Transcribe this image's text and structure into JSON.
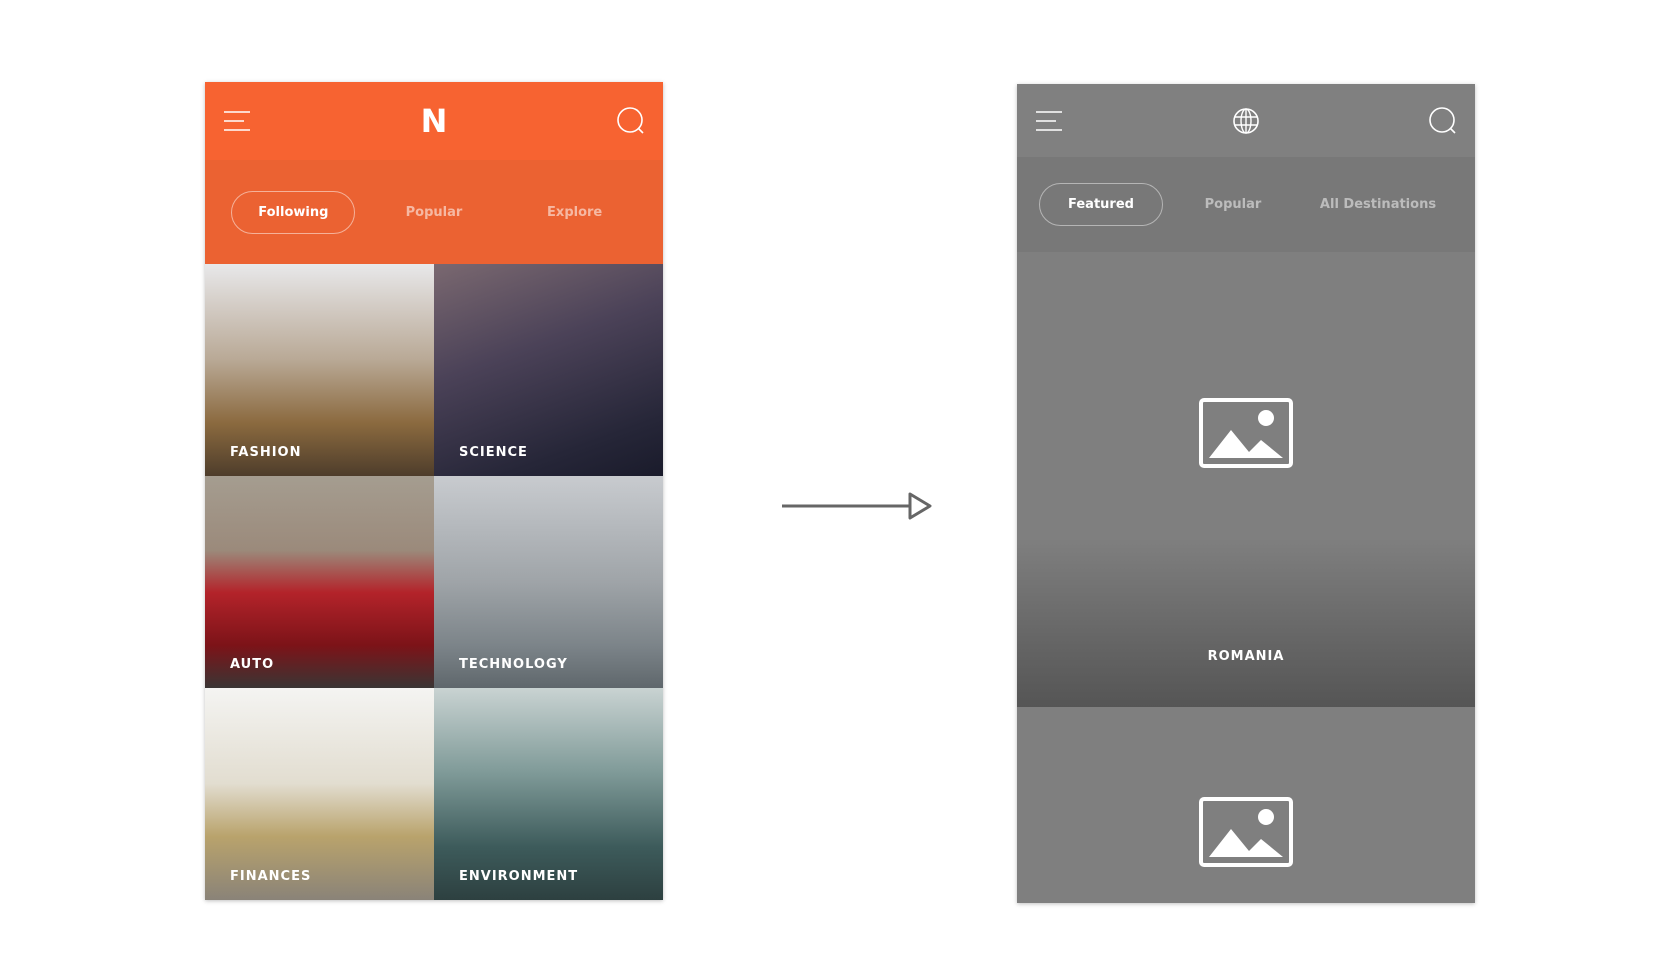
{
  "left_app": {
    "accent": "#f76331",
    "tabs": [
      "Following",
      "Popular",
      "Explore"
    ],
    "active_tab": "Following",
    "logo": "N",
    "categories": [
      "FASHION",
      "SCIENCE",
      "AUTO",
      "TECHNOLOGY",
      "FINANCES",
      "ENVIRONMENT"
    ]
  },
  "right_app": {
    "bg": "#7f7f7f",
    "tabs": [
      "Featured",
      "Popular",
      "All Destinations"
    ],
    "active_tab": "Featured",
    "cards": [
      "ROMANIA"
    ]
  },
  "icons": {
    "menu": "hamburger-icon",
    "search": "search-icon",
    "logo_right": "globe-icon",
    "placeholder": "image-placeholder-icon",
    "transition": "arrow-right-icon"
  }
}
